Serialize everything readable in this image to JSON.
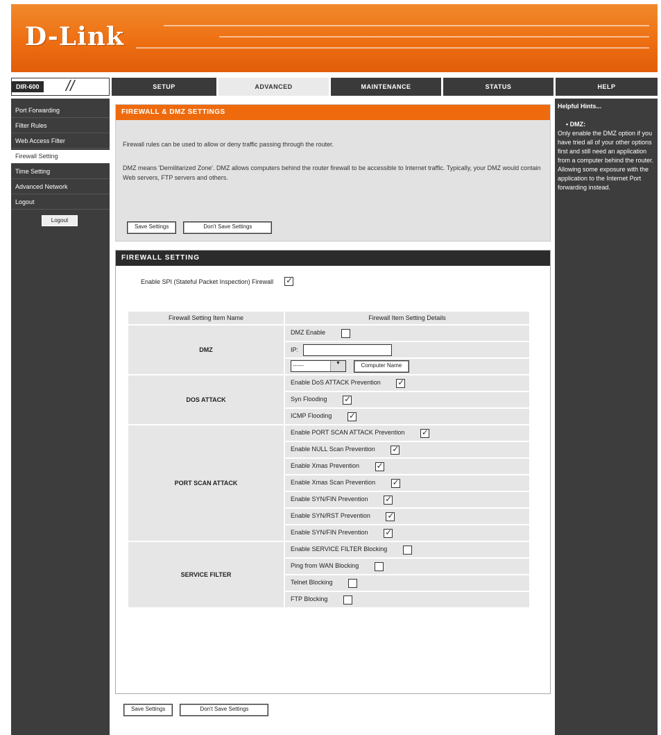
{
  "header": {
    "logo": "D-Link"
  },
  "model": {
    "label": "DIR-600"
  },
  "nav": {
    "tabs": [
      "SETUP",
      "ADVANCED",
      "MAINTENANCE",
      "STATUS"
    ],
    "help": "HELP"
  },
  "sidebar": {
    "items": [
      "Port Forwarding",
      "Filter Rules",
      "Web Access Filter",
      "Firewall Setting",
      "Time Setting",
      "Advanced Network",
      "Logout"
    ],
    "logout_button": "Logout"
  },
  "help": {
    "title": "Helpful Hints...",
    "item": "• DMZ:",
    "text": "Only enable the DMZ option if you have tried all of your other options first and still need an application from a computer behind the router. Allowing some exposure with the application to the Internet Port forwarding instead."
  },
  "section1": {
    "title": "FIREWALL & DMZ SETTINGS",
    "intro1": "Firewall rules can be used to allow or deny traffic passing through the router.",
    "intro2": "DMZ means 'Demilitarized Zone'. DMZ allows computers behind the router firewall to be accessible to Internet traffic. Typically, your DMZ would contain Web servers, FTP servers and others.",
    "save_label": "Save Settings",
    "dont_save_label": "Don't Save Settings"
  },
  "section2": {
    "title": "FIREWALL SETTING",
    "enable_label": "Enable SPI (Stateful Packet Inspection) Firewall",
    "enable_checked": true,
    "table": {
      "col1": "Firewall Setting Item Name",
      "col2": "Firewall Item Setting Details",
      "dmz": {
        "name": "DMZ",
        "enable_label": "DMZ Enable",
        "ip_label": "IP:",
        "ip_value": "",
        "mode_value": "------",
        "mode_arrow": "▼",
        "computer_list_label": "Computer Name"
      },
      "dos": {
        "name": "DOS ATTACK",
        "items": [
          {
            "label": "Enable DoS ATTACK Prevention",
            "checked": true
          },
          {
            "label": "Syn Flooding",
            "checked": true
          },
          {
            "label": "ICMP Flooding",
            "checked": true
          }
        ]
      },
      "portscan": {
        "name": "PORT SCAN ATTACK",
        "items": [
          {
            "label": "Enable PORT SCAN ATTACK Prevention",
            "checked": true
          },
          {
            "label": "Enable NULL Scan Prevention",
            "checked": true
          },
          {
            "label": "Enable Xmas Prevention",
            "checked": true
          },
          {
            "label": "Enable Xmas Scan Prevention",
            "checked": true
          },
          {
            "label": "Enable SYN/FIN Prevention",
            "checked": true
          },
          {
            "label": "Enable SYN/RST Prevention",
            "checked": true
          },
          {
            "label": "Enable SYN/FIN Prevention",
            "checked": true
          }
        ]
      },
      "service": {
        "name": "SERVICE FILTER",
        "items": [
          {
            "label": "Enable SERVICE FILTER Blocking",
            "checked": false
          },
          {
            "label": "Ping from WAN Blocking",
            "checked": false
          },
          {
            "label": "Telnet Blocking",
            "checked": false
          },
          {
            "label": "FTP Blocking",
            "checked": false
          }
        ]
      }
    }
  },
  "bottom": {
    "save_label": "Save Settings",
    "dont_save_label": "Don't Save Settings"
  }
}
